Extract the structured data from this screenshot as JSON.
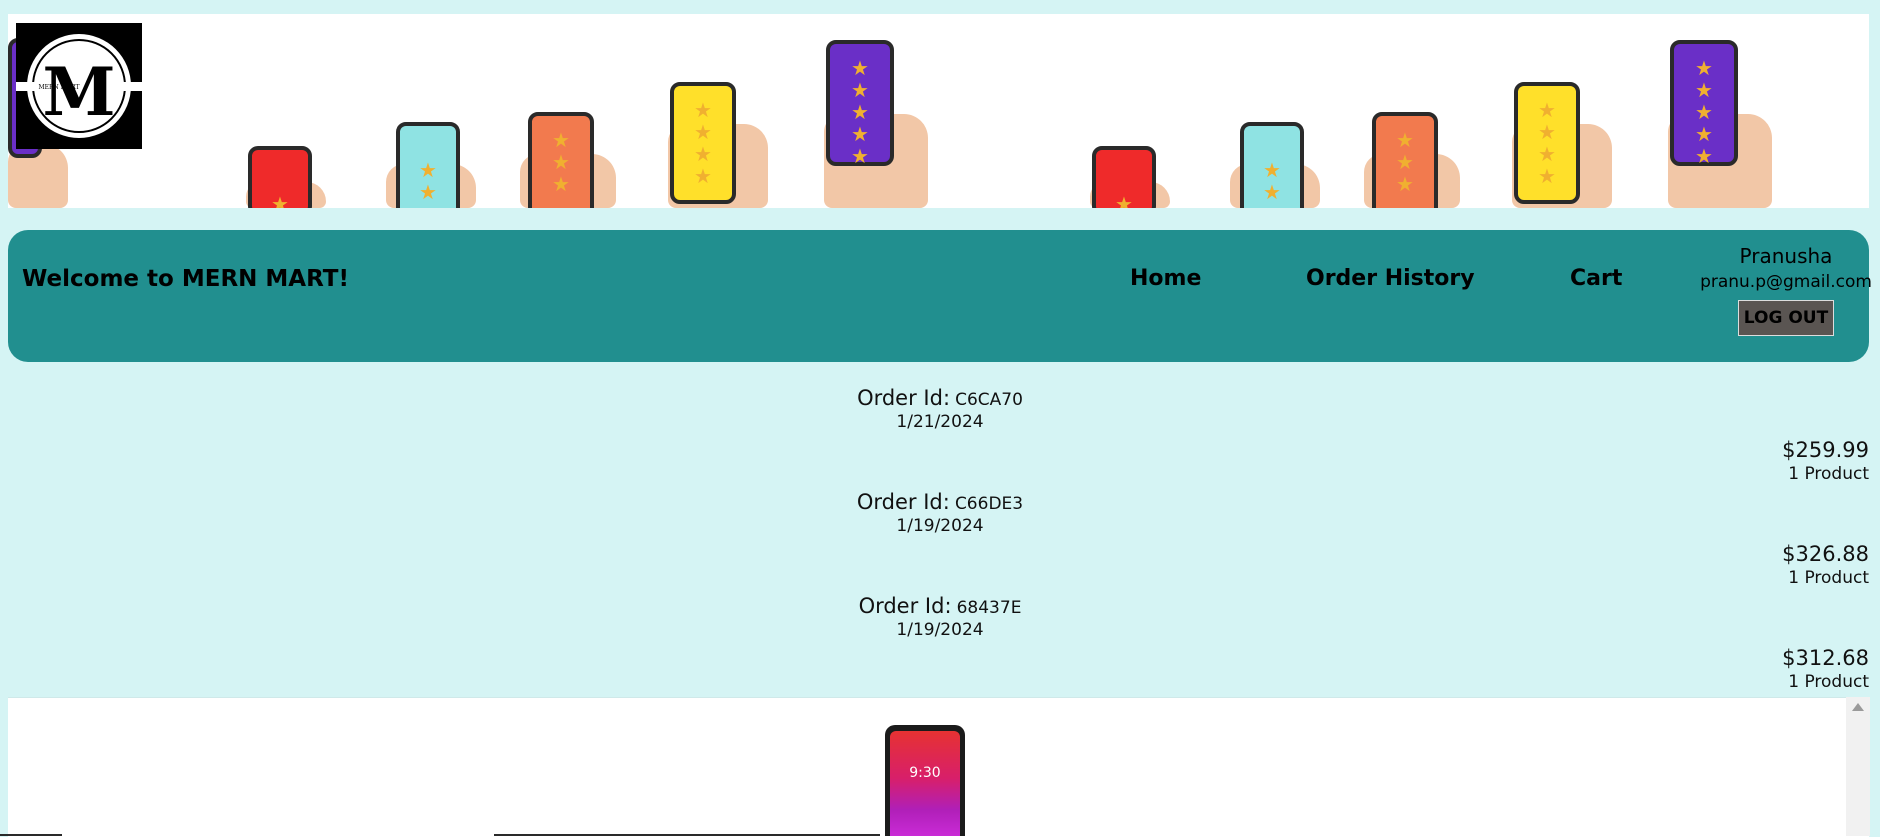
{
  "banner": {
    "logo_text": "MERN MART",
    "logo_letter": "M"
  },
  "nav": {
    "welcome": "Welcome to MERN MART!",
    "links": [
      {
        "label": "Home"
      },
      {
        "label": "Order History"
      },
      {
        "label": "Cart"
      }
    ],
    "user": {
      "name": "Pranusha",
      "email": "pranu.p@gmail.com",
      "logout_label": "LOG OUT"
    }
  },
  "orders": [
    {
      "id_label": "Order Id:",
      "id": "C6CA70",
      "date": "1/21/2024",
      "total": "$259.99",
      "count": "1 Product"
    },
    {
      "id_label": "Order Id:",
      "id": "C66DE3",
      "date": "1/19/2024",
      "total": "$326.88",
      "count": "1 Product"
    },
    {
      "id_label": "Order Id:",
      "id": "68437E",
      "date": "1/19/2024",
      "total": "$312.68",
      "count": "1 Product"
    }
  ],
  "product_preview": {
    "screen_time": "9:30"
  },
  "colors": {
    "page_bg": "#d5f4f4",
    "nav_bg": "#218f8f",
    "logout_bg": "#5a5552"
  }
}
